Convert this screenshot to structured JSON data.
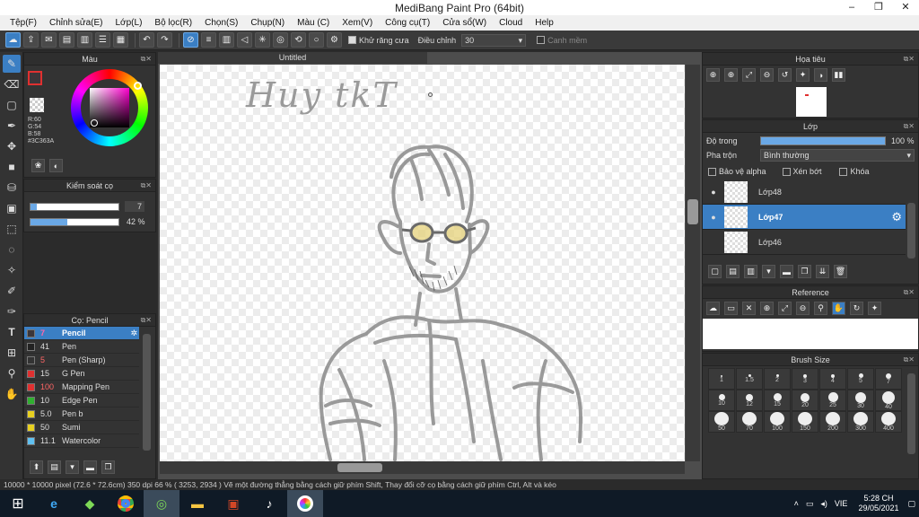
{
  "window": {
    "title": "MediBang Paint Pro (64bit)"
  },
  "menu": [
    "Tệp(F)",
    "Chỉnh sửa(E)",
    "Lớp(L)",
    "Bộ lọc(R)",
    "Chọn(S)",
    "Chụp(N)",
    "Màu (C)",
    "Xem(V)",
    "Công cụ(T)",
    "Cửa sổ(W)",
    "Cloud",
    "Help"
  ],
  "toolbar": {
    "antialias_label": "Khử răng cưa",
    "adjust_label": "Điều chỉnh",
    "adjust_value": "30",
    "snap_label": "Canh mềm"
  },
  "color_panel": {
    "title": "Màu",
    "r": "R:60",
    "g": "G:54",
    "b": "B:58",
    "hex": "#3C363A",
    "main_color": "#3C363A",
    "sub_color": "#D8C49A"
  },
  "brush_control": {
    "title": "Kiểm soát cọ",
    "size": "7",
    "size_fraction": 0.07,
    "opacity": "42 %",
    "opacity_fraction": 0.42
  },
  "brush_panel": {
    "title": "Cọ: Pencil",
    "items": [
      {
        "size": "7",
        "name": "Pencil",
        "color": "#3C363A"
      },
      {
        "size": "41",
        "name": "Pen",
        "color": "#222222"
      },
      {
        "size": "5",
        "name": "Pen (Sharp)",
        "color": "#333333"
      },
      {
        "size": "15",
        "name": "G Pen",
        "color": "#e03030"
      },
      {
        "size": "100",
        "name": "Mapping Pen",
        "color": "#e03030"
      },
      {
        "size": "10",
        "name": "Edge Pen",
        "color": "#30b030"
      },
      {
        "size": "5.0",
        "name": "Pen b",
        "color": "#e8d020"
      },
      {
        "size": "50",
        "name": "Sumi",
        "color": "#e8d020"
      },
      {
        "size": "11.1",
        "name": "Watercolor",
        "color": "#60c0f0"
      }
    ]
  },
  "document": {
    "tab": "Untitled",
    "signature_text": "Huy tkT"
  },
  "navigator": {
    "title": "Họa tiêu"
  },
  "layer_panel": {
    "title": "Lớp",
    "opacity_label": "Độ trong",
    "opacity_value": "100 %",
    "opacity_fraction": 1.0,
    "blend_label": "Pha trộn",
    "blend_value": "Bình thường",
    "protect_alpha": "Bảo vệ alpha",
    "clipping": "Xén bớt",
    "lock": "Khóa",
    "layers": [
      {
        "name": "Lớp48",
        "visible": true
      },
      {
        "name": "Lớp47",
        "visible": true
      },
      {
        "name": "Lớp46",
        "visible": false
      }
    ]
  },
  "reference": {
    "title": "Reference"
  },
  "brush_size": {
    "title": "Brush Size",
    "rows": [
      [
        "1",
        "1.5",
        "2",
        "3",
        "4",
        "5",
        "7"
      ],
      [
        "10",
        "12",
        "15",
        "20",
        "25",
        "30",
        "40"
      ],
      [
        "50",
        "70",
        "100",
        "150",
        "200",
        "300",
        "400"
      ]
    ]
  },
  "status": "10000 * 10000 pixel   (72.6 * 72.6cm)   350 dpi   66 %   ( 3253, 2934 )   Vẽ một đường thẳng bằng cách giữ phím Shift, Thay đổi cỡ cọ bằng cách giữ phím Ctrl, Alt và kéo",
  "taskbar": {
    "lang": "VIE",
    "time": "5:28 CH",
    "date": "29/05/2021"
  }
}
